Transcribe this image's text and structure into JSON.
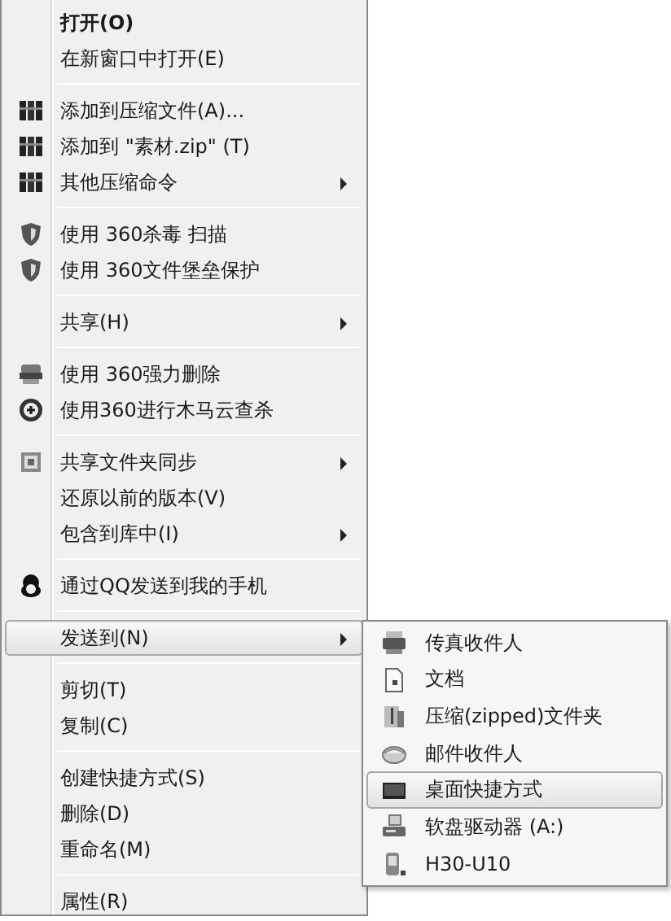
{
  "menu": {
    "sections": [
      {
        "items": [
          {
            "label": "打开(O)",
            "bold": true,
            "submenu": false,
            "selected": false
          },
          {
            "label": "在新窗口中打开(E)",
            "bold": false,
            "submenu": false,
            "selected": false
          }
        ]
      },
      {
        "items": [
          {
            "label": "添加到压缩文件(A)...",
            "bold": false,
            "submenu": false,
            "selected": false
          },
          {
            "label": "添加到 \"素材.zip\" (T)",
            "bold": false,
            "submenu": false,
            "selected": false
          },
          {
            "label": "其他压缩命令",
            "bold": false,
            "submenu": true,
            "selected": false
          }
        ]
      },
      {
        "items": [
          {
            "label": "使用 360杀毒 扫描",
            "bold": false,
            "submenu": false,
            "selected": false
          },
          {
            "label": "使用 360文件堡垒保护",
            "bold": false,
            "submenu": false,
            "selected": false
          }
        ]
      },
      {
        "items": [
          {
            "label": "共享(H)",
            "bold": false,
            "submenu": true,
            "selected": false
          }
        ]
      },
      {
        "items": [
          {
            "label": "使用 360强力删除",
            "bold": false,
            "submenu": false,
            "selected": false
          },
          {
            "label": "使用360进行木马云查杀",
            "bold": false,
            "submenu": false,
            "selected": false
          }
        ]
      },
      {
        "items": [
          {
            "label": "共享文件夹同步",
            "bold": false,
            "submenu": true,
            "selected": false
          },
          {
            "label": "还原以前的版本(V)",
            "bold": false,
            "submenu": false,
            "selected": false
          },
          {
            "label": "包含到库中(I)",
            "bold": false,
            "submenu": true,
            "selected": false
          }
        ]
      },
      {
        "items": [
          {
            "label": "通过QQ发送到我的手机",
            "bold": false,
            "submenu": false,
            "selected": false
          }
        ]
      },
      {
        "items": [
          {
            "label": "发送到(N)",
            "bold": false,
            "submenu": true,
            "selected": true
          }
        ]
      },
      {
        "items": [
          {
            "label": "剪切(T)",
            "bold": false,
            "submenu": false,
            "selected": false
          },
          {
            "label": "复制(C)",
            "bold": false,
            "submenu": false,
            "selected": false
          }
        ]
      },
      {
        "items": [
          {
            "label": "创建快捷方式(S)",
            "bold": false,
            "submenu": false,
            "selected": false
          },
          {
            "label": "删除(D)",
            "bold": false,
            "submenu": false,
            "selected": false
          },
          {
            "label": "重命名(M)",
            "bold": false,
            "submenu": false,
            "selected": false
          }
        ]
      },
      {
        "items": [
          {
            "label": "属性(R)",
            "bold": false,
            "submenu": false,
            "selected": false
          }
        ]
      }
    ]
  },
  "send_to_menu": {
    "items": [
      {
        "label": "传真收件人",
        "selected": false
      },
      {
        "label": "文档",
        "selected": false
      },
      {
        "label": "压缩(zipped)文件夹",
        "selected": false
      },
      {
        "label": "邮件收件人",
        "selected": false
      },
      {
        "label": "桌面快捷方式",
        "selected": true
      },
      {
        "label": "软盘驱动器 (A:)",
        "selected": false
      },
      {
        "label": "H30-U10",
        "selected": false
      }
    ]
  }
}
